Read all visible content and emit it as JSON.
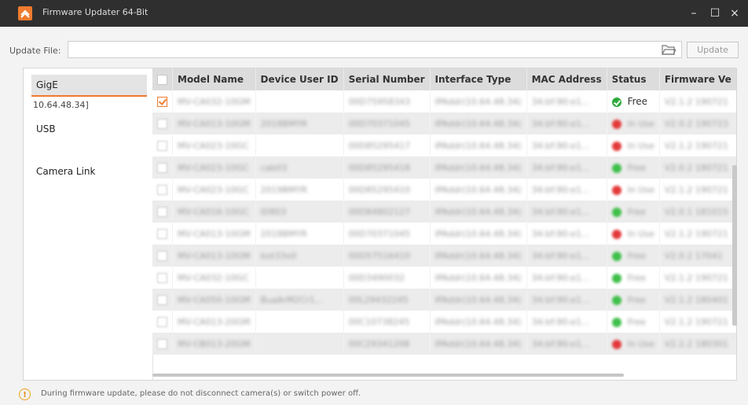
{
  "window": {
    "title": "Firmware Updater 64-Bit",
    "min_label": "–",
    "max_label": "☐",
    "close_label": "×"
  },
  "update": {
    "label": "Update File:",
    "value": "",
    "button_label": "Update"
  },
  "sidebar": {
    "gige_label": "GigE",
    "gige_ip": "10.64.48.34]",
    "usb_label": "USB",
    "cameralink_label": "Camera Link"
  },
  "table": {
    "headers": [
      "",
      "Model Name",
      "Device User ID",
      "Serial Number",
      "Interface Type",
      "MAC Address",
      "Status",
      "Firmware Ve"
    ],
    "rows": [
      {
        "checked": true,
        "model": "MV-CA032-10GM",
        "user_id": "",
        "serial": "00D75958343",
        "iface": "IPAddr(10.64.48.34)",
        "mac": "34:bf:90:e1...",
        "status": "Free",
        "status_color": "green",
        "fw": "V2.1.2 190721"
      },
      {
        "checked": false,
        "model": "MV-CA013-10GM",
        "user_id": "2018BMYR",
        "serial": "00D70371045",
        "iface": "IPAddr(10.64.48.34)",
        "mac": "34:bf:90:e1...",
        "status": "In Use",
        "status_color": "red",
        "fw": "V2.0.2 190723"
      },
      {
        "checked": false,
        "model": "MV-CA023-10GC",
        "user_id": "",
        "serial": "00D85295417",
        "iface": "IPAddr(10.64.48.34)",
        "mac": "34:bf:90:e1...",
        "status": "In Use",
        "status_color": "red",
        "fw": "V2.1.2 190721"
      },
      {
        "checked": false,
        "model": "MV-CA023-10GC",
        "user_id": "cab03",
        "serial": "00D85295418",
        "iface": "IPAddr(10.64.48.34)",
        "mac": "34:bf:90:e1...",
        "status": "Free",
        "status_color": "green",
        "fw": "V2.0.2 180721"
      },
      {
        "checked": false,
        "model": "MV-CA023-10GC",
        "user_id": "2019BMYR",
        "serial": "00D85295410",
        "iface": "IPAddr(10.64.48.34)",
        "mac": "34:bf:90:e1...",
        "status": "In Use",
        "status_color": "red",
        "fw": "V2.1.2 190721"
      },
      {
        "checked": false,
        "model": "MV-CA016-10GC",
        "user_id": "ID803",
        "serial": "00D84802127",
        "iface": "IPAddr(10.64.48.34)",
        "mac": "34:bf:90:e1...",
        "status": "Free",
        "status_color": "green",
        "fw": "V2.0.1 181015"
      },
      {
        "checked": false,
        "model": "MV-CA013-10GM",
        "user_id": "2018BMYR",
        "serial": "00D70371045",
        "iface": "IPAddr(10.64.48.34)",
        "mac": "34:bf:90:e1...",
        "status": "In Use",
        "status_color": "red",
        "fw": "V2.1.2 190721"
      },
      {
        "checked": false,
        "model": "MV-CA013-10GM",
        "user_id": "bot33x0",
        "serial": "00D57516410",
        "iface": "IPAddr(10.64.48.34)",
        "mac": "34:bf:90:e1...",
        "status": "Free",
        "status_color": "green",
        "fw": "V2.0.2 17041"
      },
      {
        "checked": false,
        "model": "MV-CA032-10GC",
        "user_id": "",
        "serial": "00D3490032",
        "iface": "IPAddr(10.64.48.34)",
        "mac": "34:bf:90:e1...",
        "status": "Free",
        "status_color": "green",
        "fw": "V2.1.2 190721"
      },
      {
        "checked": false,
        "model": "MV-CA050-10GM",
        "user_id": "BuaArM2Cr1...",
        "serial": "00L29432245",
        "iface": "IPAddr(10.64.48.34)",
        "mac": "34:bf:90:e1...",
        "status": "Free",
        "status_color": "green",
        "fw": "V2.1.2 180401"
      },
      {
        "checked": false,
        "model": "MV-CA013-20GM",
        "user_id": "",
        "serial": "00C10738245",
        "iface": "IPAddr(10.64.48.34)",
        "mac": "34:bf:90:e1...",
        "status": "Free",
        "status_color": "green",
        "fw": "V2.1.2 190721"
      },
      {
        "checked": false,
        "model": "MV-CB013-20GM",
        "user_id": "",
        "serial": "00C29341208",
        "iface": "IPAddr(10.64.48.34)",
        "mac": "34:bf:90:e1...",
        "status": "In Use",
        "status_color": "red",
        "fw": "V2.2.2 180301"
      }
    ]
  },
  "footer": {
    "message": "During firmware update, please do not disconnect camera(s) or switch power off."
  },
  "colors": {
    "accent": "#f07b2e",
    "free": "#3fbf4a",
    "in_use": "#e23a3a",
    "titlebar": "#2f2f2f"
  },
  "icons": {
    "app": "app-logo-icon",
    "folder": "folder-icon",
    "warning": "warning-icon"
  }
}
